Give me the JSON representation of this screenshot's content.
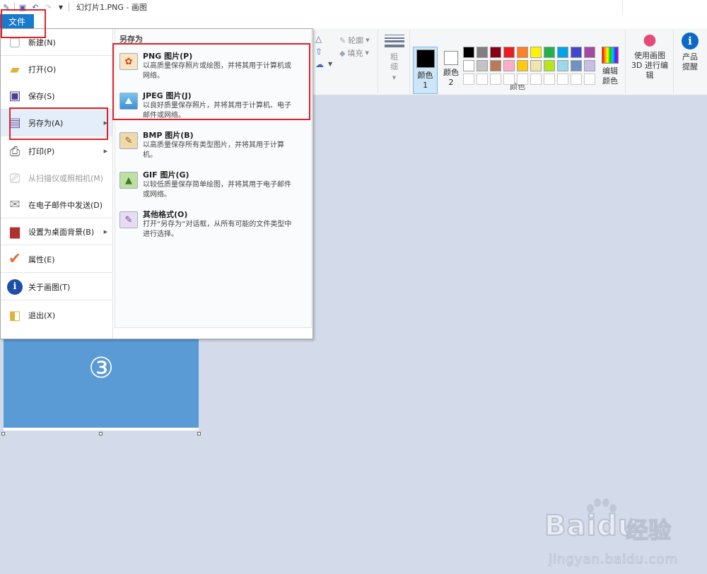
{
  "window": {
    "title": "幻灯片1.PNG - 画图"
  },
  "file_tab": {
    "label": "文件"
  },
  "file_menu": {
    "items": [
      {
        "label": "新建(N)"
      },
      {
        "label": "打开(O)"
      },
      {
        "label": "保存(S)"
      },
      {
        "label": "另存为(A)"
      },
      {
        "label": "打印(P)"
      },
      {
        "label": "从扫描仪或照相机(M)"
      },
      {
        "label": "在电子邮件中发送(D)"
      },
      {
        "label": "设置为桌面背景(B)"
      },
      {
        "label": "属性(E)"
      },
      {
        "label": "关于画图(T)"
      },
      {
        "label": "退出(X)"
      }
    ],
    "submenu": {
      "header": "另存为",
      "formats": [
        {
          "title": "PNG 图片(P)",
          "desc": "以高质量保存照片或绘图，并将其用于计算机或网络。"
        },
        {
          "title": "JPEG 图片(J)",
          "desc": "以良好质量保存照片，并将其用于计算机、电子邮件或网络。"
        },
        {
          "title": "BMP 图片(B)",
          "desc": "以高质量保存所有类型图片，并将其用于计算机。"
        },
        {
          "title": "GIF 图片(G)",
          "desc": "以较低质量保存简单绘图，并将其用于电子邮件或网络。"
        },
        {
          "title": "其他格式(O)",
          "desc": "打开“另存为”对话框，从所有可能的文件类型中进行选择。"
        }
      ]
    }
  },
  "ribbon": {
    "outline_label": "轮廓",
    "fill_label": "填充",
    "size_label": "粗细",
    "color1_label": "颜色 1",
    "color2_label": "颜色 2",
    "colors_group_label": "颜色",
    "edit_colors_label": "编辑颜色",
    "paint3d_label": "使用画图 3D 进行编辑",
    "product_alert_label": "产品提醒",
    "color1": "#000000",
    "color2": "#ffffff",
    "palette": [
      "#000000",
      "#7f7f7f",
      "#880015",
      "#ed1c24",
      "#ff7f27",
      "#fff200",
      "#22b14c",
      "#00a2e8",
      "#3f48cc",
      "#a349a4",
      "#ffffff",
      "#c3c3c3",
      "#b97a57",
      "#ffaec9",
      "#ffc90e",
      "#efe4b0",
      "#b5e61d",
      "#99d9ea",
      "#7092be",
      "#c8bfe7",
      "#ffffff",
      "#ffffff",
      "#ffffff",
      "#ffffff",
      "#ffffff",
      "#ffffff",
      "#ffffff",
      "#ffffff",
      "#ffffff",
      "#ffffff"
    ]
  },
  "canvas": {
    "text": "③",
    "fill": "#5b9bd5"
  },
  "watermark": {
    "logo": "Baidu",
    "cn": "经验",
    "url": "jingyan.baidu.com"
  },
  "colors": {
    "highlight": "#e0212a",
    "accent": "#1979ca"
  }
}
